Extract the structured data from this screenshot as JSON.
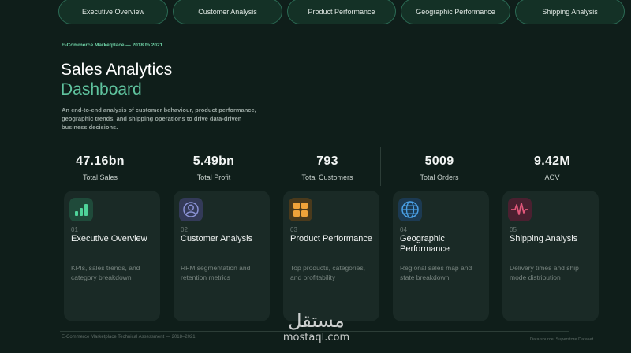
{
  "nav": {
    "tabs": [
      {
        "label": "Executive Overview"
      },
      {
        "label": "Customer Analysis"
      },
      {
        "label": "Product Performance"
      },
      {
        "label": "Geographic Performance"
      },
      {
        "label": "Shipping Analysis"
      }
    ]
  },
  "hero": {
    "eyebrow": "E-Commerce Marketplace — 2018 to 2021",
    "title_line1": "Sales Analytics",
    "title_line2": "Dashboard",
    "description": "An end-to-end analysis of customer behaviour, product performance, geographic trends, and shipping operations to drive data-driven business decisions."
  },
  "kpis": [
    {
      "value": "47.16bn",
      "label": "Total Sales"
    },
    {
      "value": "5.49bn",
      "label": "Total Profit"
    },
    {
      "value": "793",
      "label": "Total Customers"
    },
    {
      "value": "5009",
      "label": "Total Orders"
    },
    {
      "value": "9.42M",
      "label": "AOV"
    }
  ],
  "cards": [
    {
      "num": "01",
      "title": "Executive Overview",
      "desc": "KPIs, sales trends, and category breakdown",
      "icon": "bar-chart-icon",
      "icon_color": "#4fd39a"
    },
    {
      "num": "02",
      "title": "Customer Analysis",
      "desc": "RFM segmentation and retention metrics",
      "icon": "user-icon",
      "icon_color": "#8b93d6"
    },
    {
      "num": "03",
      "title": "Product Performance",
      "desc": "Top products, categories, and profitability",
      "icon": "grid-icon",
      "icon_color": "#f0a33a"
    },
    {
      "num": "04",
      "title": "Geographic Performance",
      "desc": "Regional sales map and state breakdown",
      "icon": "globe-icon",
      "icon_color": "#4aa0e6"
    },
    {
      "num": "05",
      "title": "Shipping Analysis",
      "desc": "Delivery times and ship mode distribution",
      "icon": "pulse-icon",
      "icon_color": "#e0577a"
    }
  ],
  "footer": {
    "left": "E-Commerce Marketplace Technical Assessment — 2018–2021",
    "right": "Data source: Superstore Dataset"
  },
  "watermark": {
    "arabic": "مستقل",
    "latin": "mostaql.com"
  }
}
